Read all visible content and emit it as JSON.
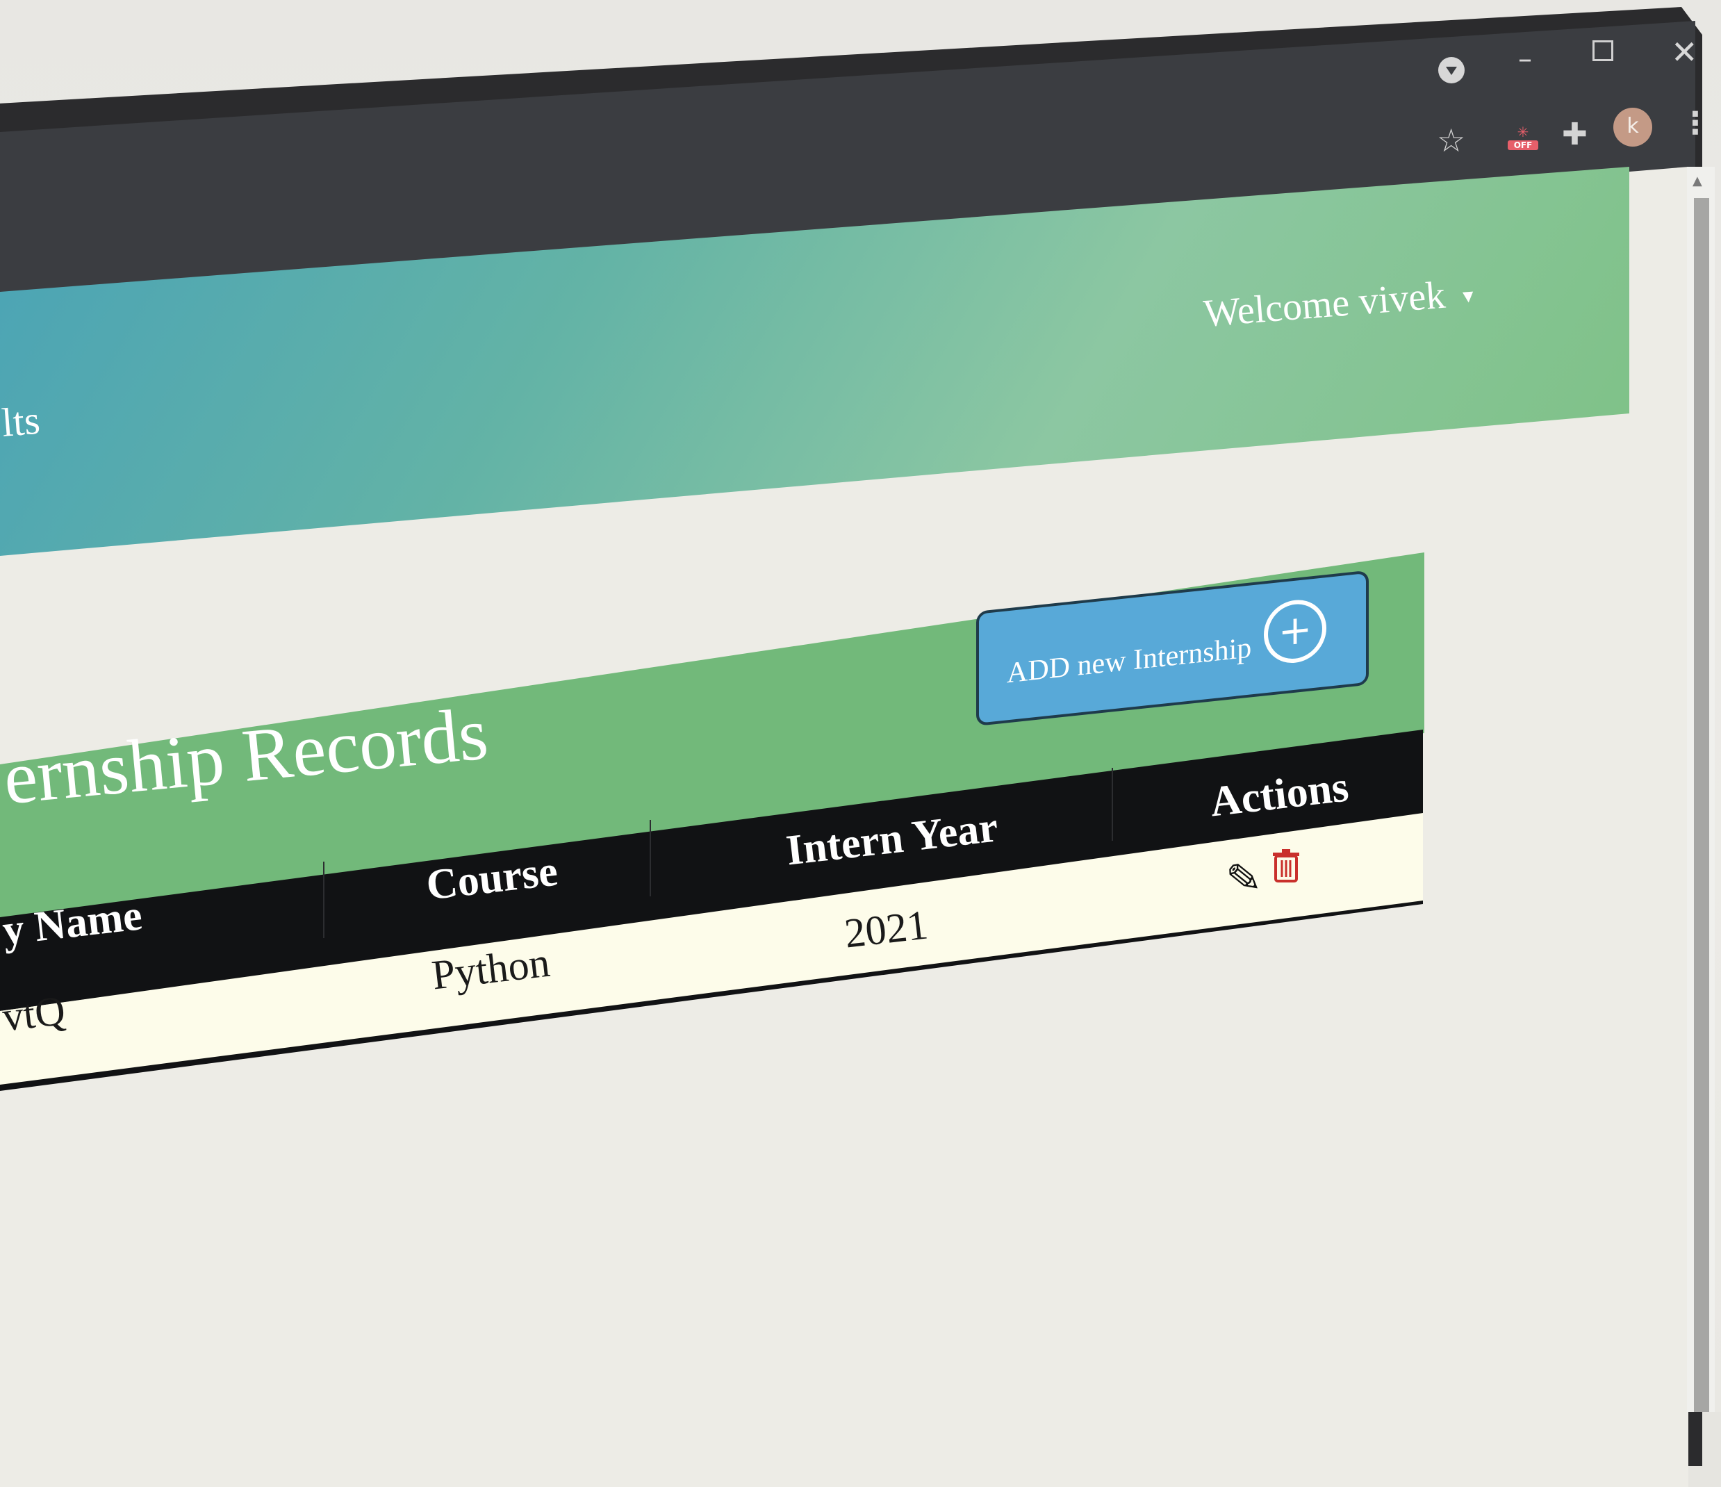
{
  "header": {
    "nav_partial": "lts",
    "welcome": "Welcome vivek",
    "caret": "▼"
  },
  "toolbar": {
    "avatar_letter": "k",
    "ext_badge": "OFF"
  },
  "card": {
    "title": "ernship Records",
    "add_button_label": "ADD new Internship"
  },
  "table": {
    "headers": [
      "y Name",
      "Course",
      "Intern Year",
      "Actions"
    ],
    "rows": [
      {
        "company": "vtQ",
        "course": "Python",
        "year": "2021"
      }
    ]
  },
  "colors": {
    "header_gradient_start": "#4aa3b6",
    "header_gradient_end": "#7ec185",
    "card_green": "#72b97a",
    "button_blue": "#58a9d8",
    "table_header": "#111214",
    "row_bg": "#fdfcea",
    "delete_red": "#c9302c"
  },
  "icons": [
    "profile-menu-icon",
    "minimize-icon",
    "maximize-icon",
    "close-icon",
    "star-icon",
    "extension-off-icon",
    "puzzle-icon",
    "kebab-menu-icon",
    "plus-icon",
    "pencil-icon",
    "trash-icon"
  ]
}
